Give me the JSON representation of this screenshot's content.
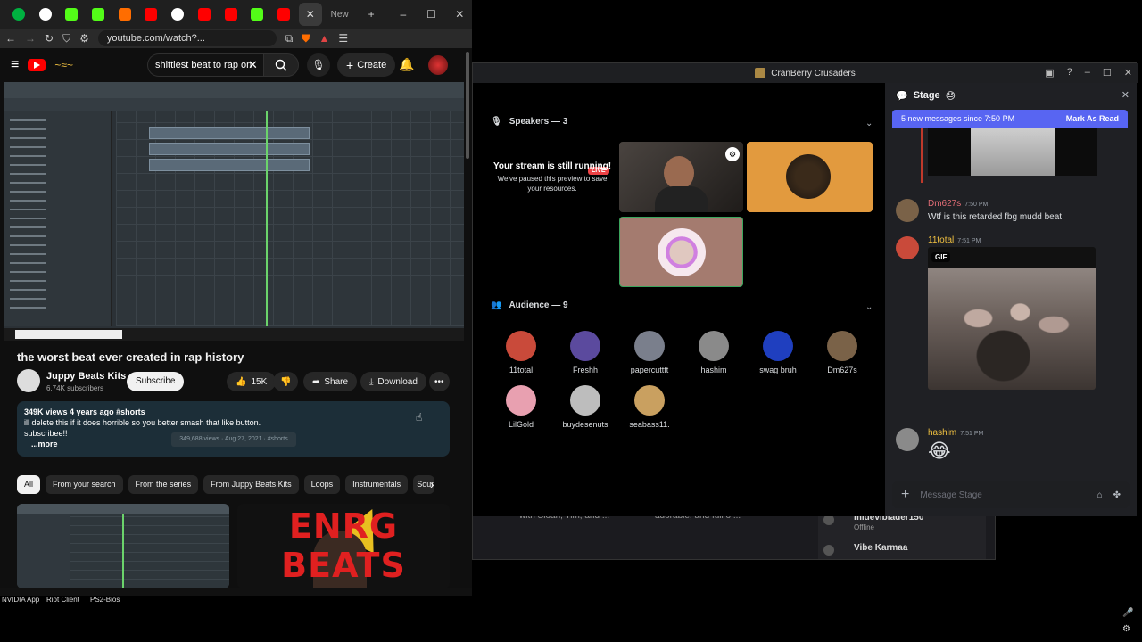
{
  "browser": {
    "new_tab_label": "New",
    "url": "youtube.com/watch?...",
    "tab_colors": [
      "#00b140",
      "#ffffff",
      "#53fc18",
      "#53fc18",
      "#ff6d00",
      "#ff0000",
      "#ffffff",
      "#ff0000",
      "#ff0000",
      "#53fc18",
      "#ff0000"
    ]
  },
  "youtube": {
    "search_query": "shittiest beat to rap on",
    "create_label": "Create",
    "video_title": "the worst beat ever created in rap history",
    "channel_name": "Juppy Beats Kits",
    "subscriber_count": "6.74K subscribers",
    "subscribe_label": "Subscribe",
    "like_count": "15K",
    "share_label": "Share",
    "download_label": "Download",
    "views_line": "349K views  4 years ago  #shorts",
    "desc_line1": "ill delete this if it does horrible so you better smash that like button.",
    "desc_line2": "subscribee!!",
    "more_label": "...more",
    "desc_tooltip": "349,688 views · Aug 27, 2021 · #shorts",
    "chips": [
      "All",
      "From your search",
      "From the series",
      "From Juppy Beats Kits",
      "Loops",
      "Instrumentals",
      "Soun"
    ],
    "thumb2_text": "ENRG BEATS"
  },
  "desktop": {
    "icons": [
      "NVIDIA App",
      "Riot Client",
      "PS2-Bios"
    ]
  },
  "behind_window": {
    "text1": "with Sloan, Tim, and ...",
    "text2": "adorable, and full of...",
    "user1": "mideviblader150",
    "user1_status": "Offline",
    "user2": "Vibe Karmaa"
  },
  "discord": {
    "window_title": "CranBerry Crusaders",
    "speakers_header": "Speakers — 3",
    "audience_header": "Audience — 9",
    "live_badge": "LIVE",
    "stream_title": "Your stream is still running!",
    "stream_sub": "We've paused this preview to save your resources.",
    "audience": [
      {
        "name": "11total",
        "color": "#c94a3a"
      },
      {
        "name": "Freshh",
        "color": "#5b4a9e"
      },
      {
        "name": "papercutttt",
        "color": "#7a7f8c"
      },
      {
        "name": "hashim",
        "color": "#8a8a8a"
      },
      {
        "name": "swag bruh",
        "color": "#1f3fbf"
      },
      {
        "name": "Dm627s",
        "color": "#7a6248"
      },
      {
        "name": "LilGold",
        "color": "#e8a0b0"
      },
      {
        "name": "buydesenuts",
        "color": "#bdbdbd"
      },
      {
        "name": "seabass11.",
        "color": "#c9a060"
      }
    ],
    "chat": {
      "title": "Stage",
      "new_messages": "5 new messages since 7:50 PM",
      "mark_read": "Mark As Read",
      "messages": [
        {
          "author": "Dm627s",
          "time": "7:50 PM",
          "text": "Wtf is this retarded fbg mudd beat",
          "color": "#e06c75"
        },
        {
          "author": "11total",
          "time": "7:51 PM",
          "text": "",
          "color": "#f0c040"
        },
        {
          "author": "hashim",
          "time": "7:51 PM",
          "text": "😂",
          "color": "#f0c040"
        }
      ],
      "gif_label": "GIF",
      "input_placeholder": "Message Stage"
    }
  }
}
